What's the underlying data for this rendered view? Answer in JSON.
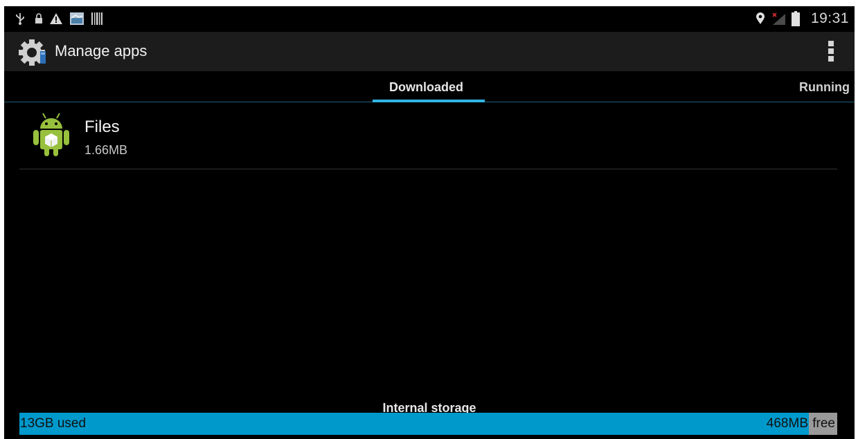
{
  "status_bar": {
    "time": "19:31",
    "icons": [
      "usb-icon",
      "lock-icon",
      "warning-icon",
      "image-notification-icon",
      "barcode-icon",
      "location-icon",
      "no-signal-icon",
      "battery-icon"
    ]
  },
  "action_bar": {
    "title": "Manage apps",
    "icon": "settings-gear-icon",
    "overflow_icon": "overflow-menu-icon"
  },
  "tabs": [
    {
      "label": "Downloaded",
      "selected": true
    },
    {
      "label": "Running",
      "selected": false
    }
  ],
  "apps": [
    {
      "name": "Files",
      "size": "1.66MB",
      "icon": "android-app-icon"
    }
  ],
  "storage": {
    "label": "Internal storage",
    "used": "13GB used",
    "free_amount": "468MB",
    "free_word": "free",
    "used_fraction": 0.965
  },
  "colors": {
    "accent": "#33b5e5",
    "storage_used": "#0099cc",
    "storage_free": "#9a9a9a",
    "android_green": "#97c03d"
  }
}
